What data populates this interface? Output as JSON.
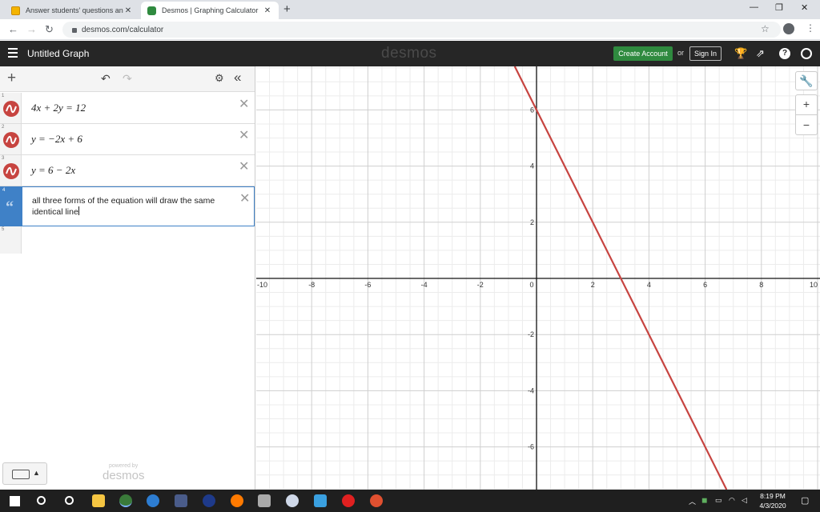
{
  "browser": {
    "tabs": [
      {
        "title": "Answer students' questions and ",
        "active": false
      },
      {
        "title": "Desmos | Graphing Calculator",
        "active": true
      }
    ],
    "url": "desmos.com/calculator"
  },
  "header": {
    "title": "Untitled Graph",
    "logo": "desmos",
    "create_account": "Create Account",
    "or": "or",
    "sign_in": "Sign In",
    "help": "?"
  },
  "expressions": [
    {
      "num": "1",
      "latex": "4x + 2y = 12"
    },
    {
      "num": "2",
      "latex": "y = −2x + 6"
    },
    {
      "num": "3",
      "latex": "y = 6 − 2x"
    }
  ],
  "note": {
    "num": "4",
    "text": "all three forms of the equation will draw the same identical line"
  },
  "empty_row_num": "5",
  "branding": {
    "powered_by": "powered by",
    "logo": "desmos"
  },
  "graph": {
    "line_color": "#c74440",
    "x_ticks": [
      "-10",
      "-8",
      "-6",
      "-4",
      "-2",
      "0",
      "2",
      "4",
      "6",
      "8",
      "10"
    ],
    "y_ticks": [
      "6",
      "4",
      "2",
      "-2",
      "-4",
      "-6"
    ],
    "xlim": [
      -10,
      10
    ],
    "ylim": [
      -7.5,
      7.5
    ],
    "line": {
      "slope": -2,
      "intercept": 6
    }
  },
  "taskbar": {
    "time": "8:19 PM",
    "date": "4/3/2020"
  }
}
